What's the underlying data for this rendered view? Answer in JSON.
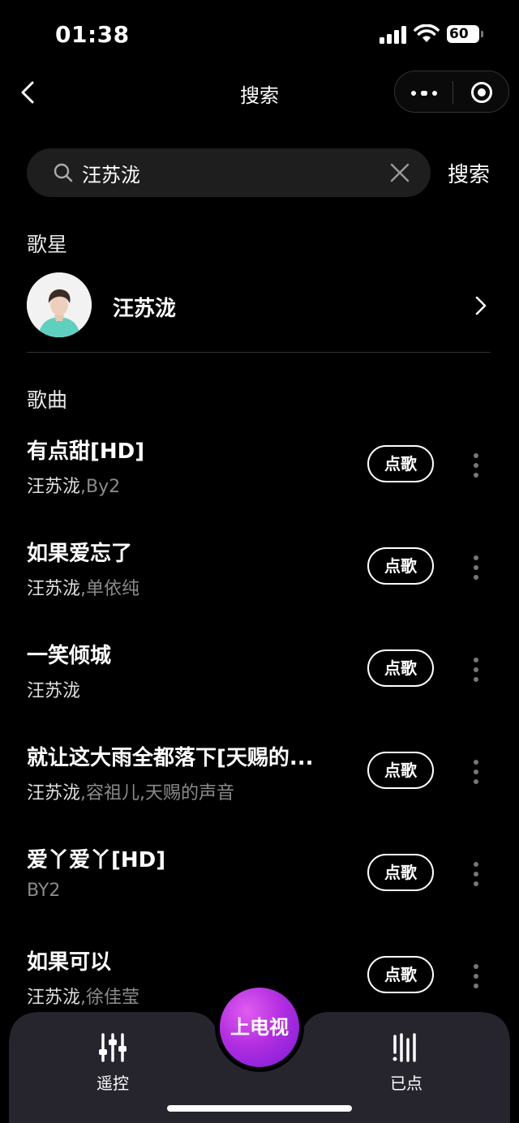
{
  "status_bar": {
    "time": "01:38",
    "battery": "60"
  },
  "nav": {
    "title": "搜索"
  },
  "search": {
    "value": "汪苏泷",
    "button_label": "搜索"
  },
  "sections": {
    "singer": "歌星",
    "songs": "歌曲"
  },
  "singer": {
    "name": "汪苏泷"
  },
  "songs": [
    {
      "title": "有点甜[HD]",
      "artist_main": "汪苏泷",
      "artist_rest": ",By2",
      "button": "点歌"
    },
    {
      "title": "如果爱忘了",
      "artist_main": "汪苏泷",
      "artist_rest": ",单依纯",
      "button": "点歌"
    },
    {
      "title": "一笑倾城",
      "artist_main": "汪苏泷",
      "artist_rest": "",
      "button": "点歌"
    },
    {
      "title": "就让这大雨全都落下[天赐的...",
      "artist_main": "汪苏泷",
      "artist_rest": ",容祖儿,天赐的声音",
      "button": "点歌"
    },
    {
      "title": "爱丫爱丫[HD]",
      "artist_main": "",
      "artist_rest": "BY2",
      "button": "点歌"
    },
    {
      "title": "如果可以",
      "artist_main": "汪苏泷",
      "artist_rest": ",徐佳莹",
      "button": "点歌"
    }
  ],
  "bottom_bar": {
    "remote_label": "遥控",
    "tv_label": "上电视",
    "ordered_label": "已点"
  },
  "colors": {
    "tv_button": "#b22ee0",
    "bottom_bar": "#26252e",
    "search_bg": "#1e1e1e"
  }
}
